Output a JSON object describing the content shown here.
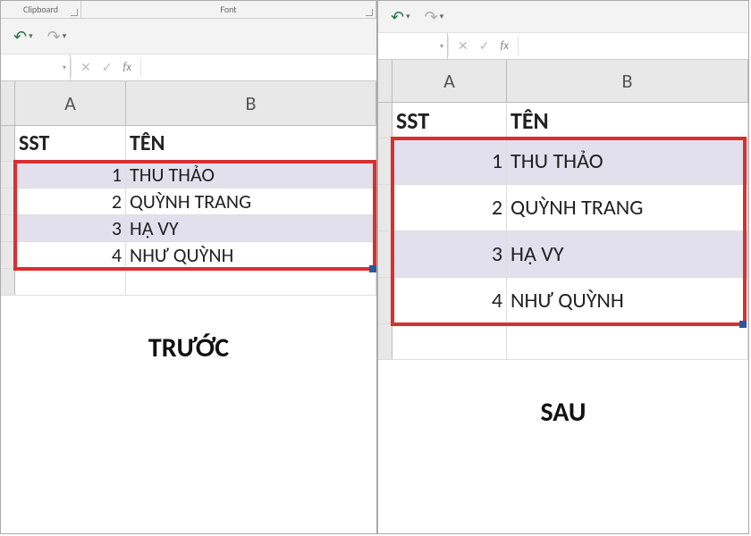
{
  "ribbon": {
    "clipboard": "Clipboard",
    "font": "Font"
  },
  "toolbar": {
    "undo_glyph": "↶",
    "redo_glyph": "↷",
    "fx_label": "fx",
    "cancel_glyph": "✕",
    "confirm_glyph": "✓",
    "dropdown_glyph": "▾"
  },
  "left": {
    "col_a": "A",
    "col_b": "B",
    "header_a": "SST",
    "header_b": "TÊN",
    "rows": [
      {
        "n": "1",
        "name": "THU THẢO"
      },
      {
        "n": "2",
        "name": "QUỲNH TRANG"
      },
      {
        "n": "3",
        "name": "HẠ VY"
      },
      {
        "n": "4",
        "name": "NHƯ QUỲNH"
      }
    ],
    "caption": "TRƯỚC"
  },
  "right": {
    "col_a": "A",
    "col_b": "B",
    "header_a": "SST",
    "header_b": "TÊN",
    "rows": [
      {
        "n": "1",
        "name": "THU THẢO"
      },
      {
        "n": "2",
        "name": "QUỲNH TRANG"
      },
      {
        "n": "3",
        "name": "HẠ VY"
      },
      {
        "n": "4",
        "name": "NHƯ QUỲNH"
      }
    ],
    "caption": "SAU"
  }
}
